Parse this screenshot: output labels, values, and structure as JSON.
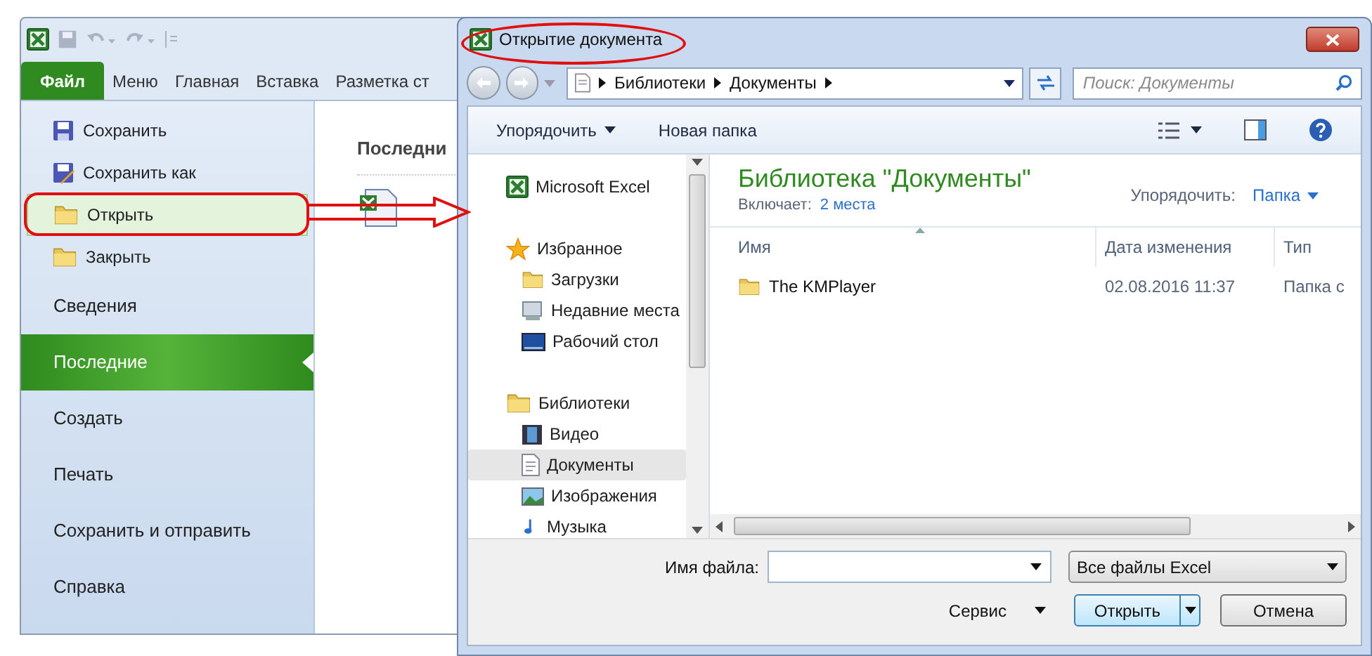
{
  "excel": {
    "tabs": [
      {
        "label": "Файл",
        "selected": true
      },
      {
        "label": "Меню",
        "selected": false
      },
      {
        "label": "Главная",
        "selected": false
      },
      {
        "label": "Вставка",
        "selected": false
      },
      {
        "label": "Разметка ст",
        "selected": false
      }
    ],
    "menu": [
      {
        "kind": "command",
        "label": "Сохранить",
        "hovered": false
      },
      {
        "kind": "command",
        "label": "Сохранить как",
        "hovered": false
      },
      {
        "kind": "command",
        "label": "Открыть",
        "hovered": true
      },
      {
        "kind": "command",
        "label": "Закрыть",
        "hovered": false
      },
      {
        "kind": "section",
        "label": "Сведения",
        "selected": false
      },
      {
        "kind": "section",
        "label": "Последние",
        "selected": true
      },
      {
        "kind": "section",
        "label": "Создать",
        "selected": false
      },
      {
        "kind": "section",
        "label": "Печать",
        "selected": false
      },
      {
        "kind": "section",
        "label": "Сохранить и отправить",
        "selected": false
      },
      {
        "kind": "section",
        "label": "Справка",
        "selected": false
      }
    ],
    "recent": {
      "title": "Последни"
    }
  },
  "dialog": {
    "title": "Открытие документа",
    "breadcrumb": [
      "Библиотеки",
      "Документы"
    ],
    "search": {
      "placeholder": "Поиск: Документы"
    },
    "toolbar": [
      {
        "label": "Упорядочить",
        "dropdown": true
      },
      {
        "label": "Новая папка",
        "dropdown": false
      }
    ],
    "nav": [
      {
        "label": "Microsoft Excel",
        "selected": false
      },
      {
        "label": "Избранное",
        "selected": false,
        "children": [
          {
            "label": "Загрузки",
            "selected": false
          },
          {
            "label": "Недавние места",
            "selected": false
          },
          {
            "label": "Рабочий стол",
            "selected": false
          }
        ]
      },
      {
        "label": "Библиотеки",
        "selected": false,
        "children": [
          {
            "label": "Видео",
            "selected": false
          },
          {
            "label": "Документы",
            "selected": true
          },
          {
            "label": "Изображения",
            "selected": false
          },
          {
            "label": "Музыка",
            "selected": false
          }
        ]
      }
    ],
    "library": {
      "title": "Библиотека \"Документы\"",
      "includes_label": "Включает:",
      "includes_link": "2 места",
      "arrange_label": "Упорядочить:",
      "arrange_value": "Папка"
    },
    "table": {
      "columns": [
        "Имя",
        "Дата изменения",
        "Тип"
      ],
      "rows": [
        {
          "name": "The KMPlayer",
          "date": "02.08.2016 11:37",
          "type": "Папка с"
        }
      ]
    },
    "filename": {
      "label": "Имя файла:"
    },
    "filter": {
      "value": "Все файлы Excel"
    },
    "tools": {
      "label": "Сервис"
    },
    "buttons": [
      {
        "label": "Открыть",
        "default": true,
        "split": true
      },
      {
        "label": "Отмена",
        "default": false,
        "split": false
      }
    ]
  }
}
